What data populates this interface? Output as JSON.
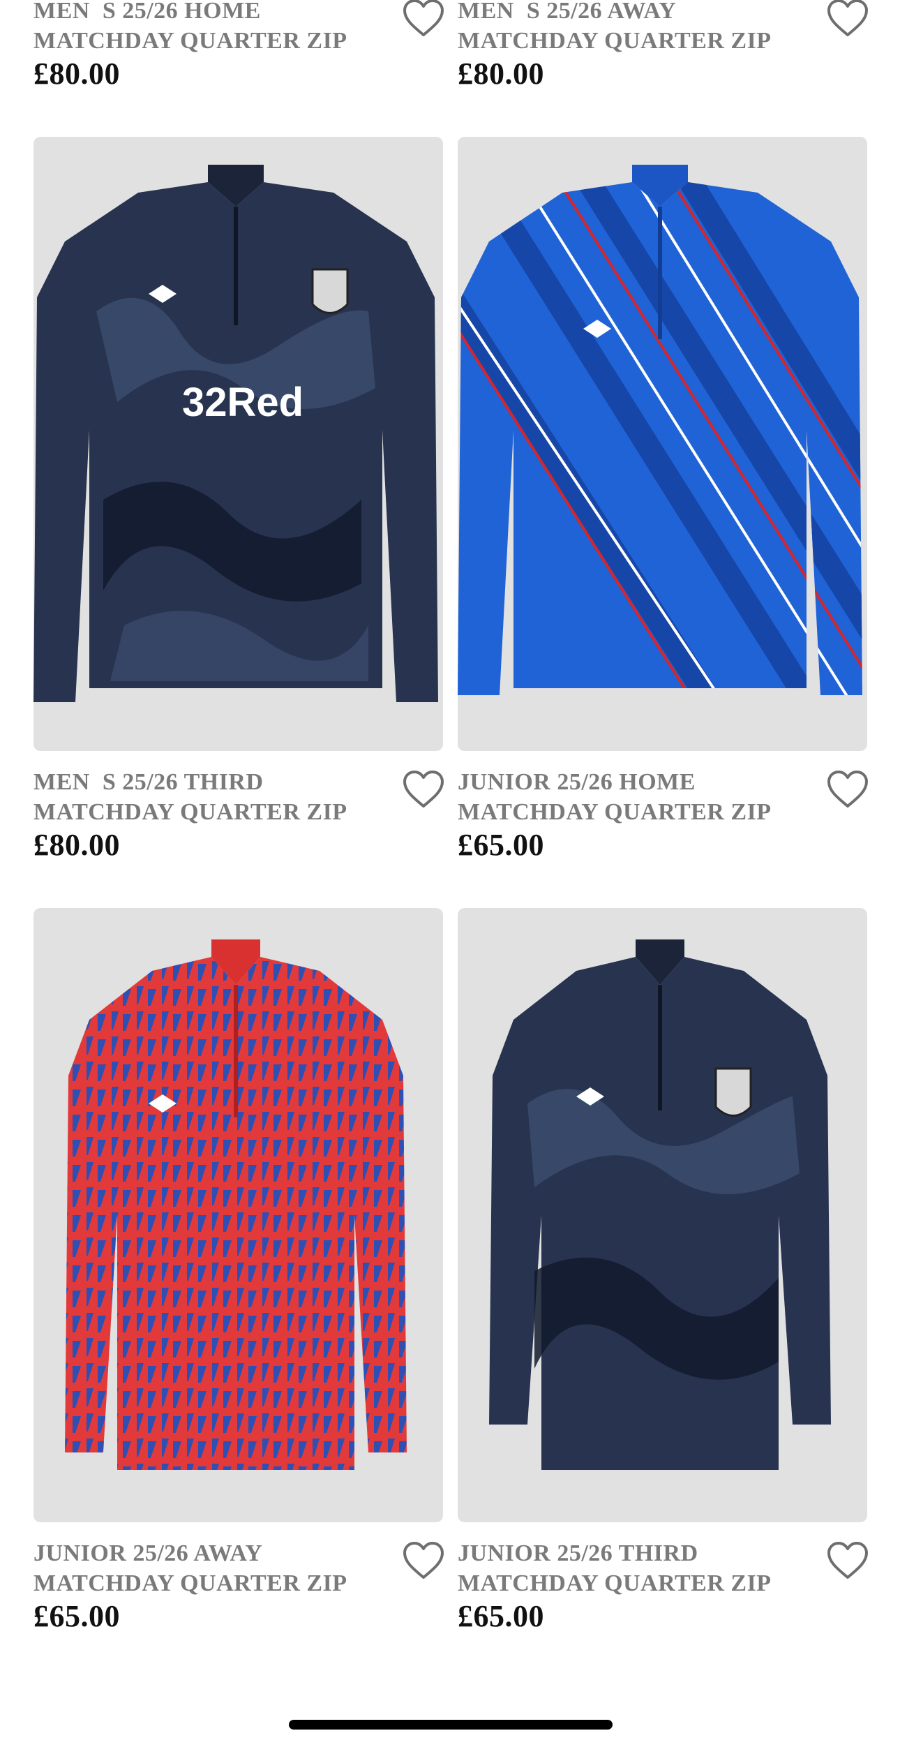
{
  "products": [
    {
      "title": "MEN  S 25/26 HOME\nMATCHDAY QUARTER ZIP",
      "price": "£80.00",
      "image_icon": "navy-camo-quarter-zip",
      "color": "#1e2a44"
    },
    {
      "title": "MEN  S 25/26 AWAY\nMATCHDAY QUARTER ZIP",
      "price": "£80.00",
      "image_icon": "blue-striped-quarter-zip",
      "color": "#1f63d6"
    },
    {
      "title": "MEN  S 25/26 THIRD\nMATCHDAY QUARTER ZIP",
      "price": "£80.00",
      "image_icon": "navy-camo-quarter-zip-32red",
      "color": "#1e2a44",
      "sponsor": "32Red"
    },
    {
      "title": "JUNIOR 25/26 HOME\nMATCHDAY QUARTER ZIP",
      "price": "£65.00",
      "image_icon": "blue-striped-quarter-zip",
      "color": "#1f63d6"
    },
    {
      "title": "JUNIOR 25/26 AWAY\nMATCHDAY QUARTER ZIP",
      "price": "£65.00",
      "image_icon": "red-pattern-quarter-zip",
      "color": "#e23a3a"
    },
    {
      "title": "JUNIOR 25/26 THIRD\nMATCHDAY QUARTER ZIP",
      "price": "£65.00",
      "image_icon": "navy-camo-quarter-zip",
      "color": "#1e2a44"
    }
  ],
  "icons": {
    "wishlist": "heart-outline-icon"
  },
  "colors": {
    "title": "#7a7a7a",
    "price": "#111111",
    "image_bg": "#e1e1e1"
  }
}
